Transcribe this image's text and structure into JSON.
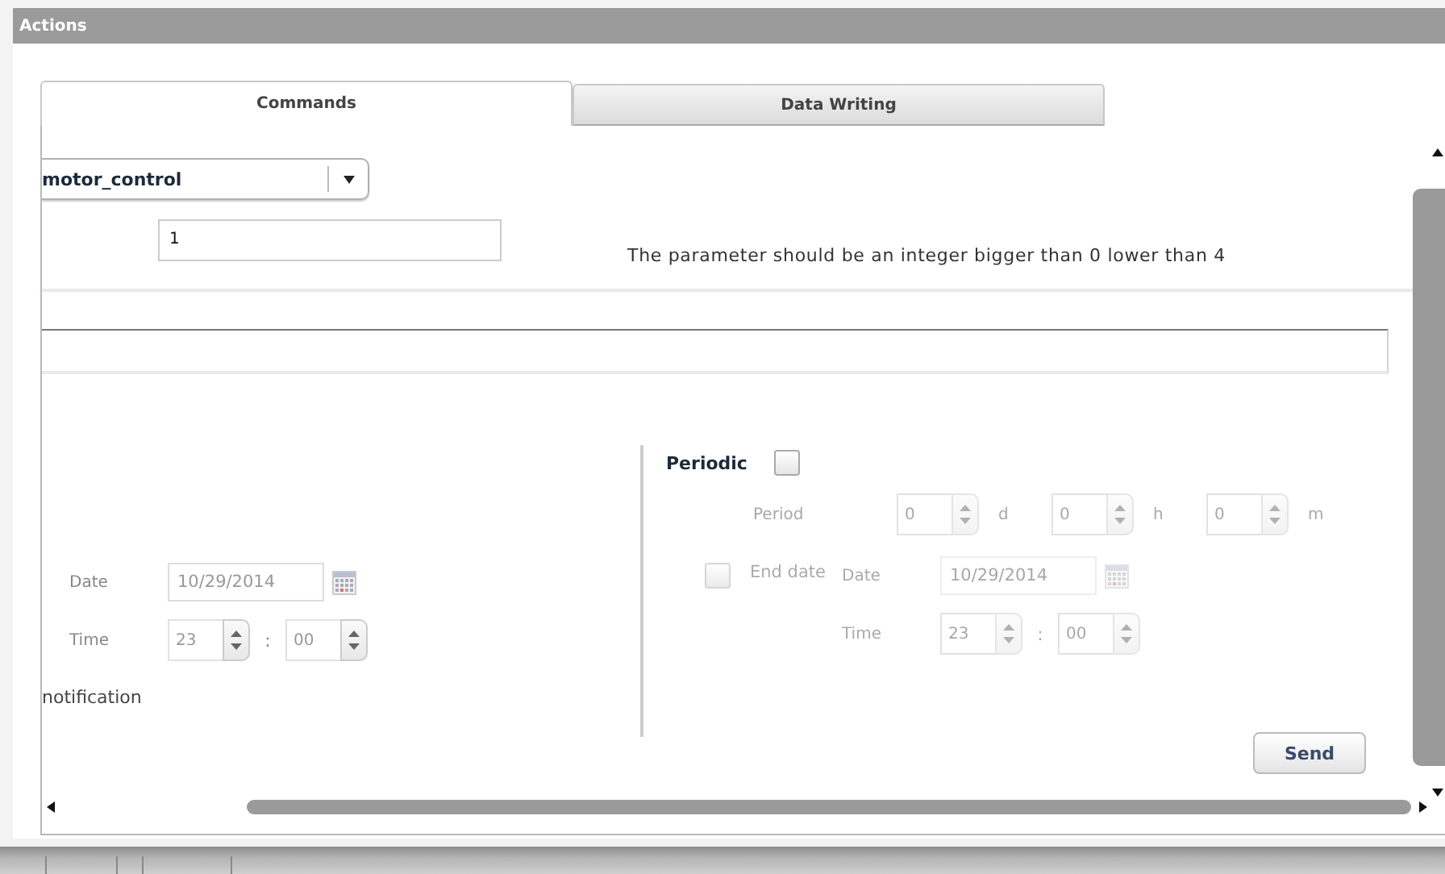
{
  "window": {
    "title": "Actions"
  },
  "tabs": [
    {
      "label": "Commands",
      "selected": true
    },
    {
      "label": "Data Writing",
      "selected": false
    }
  ],
  "command": {
    "value": "motor_control"
  },
  "parameter": {
    "value": "1",
    "hint": "The parameter should be an integer bigger than 0 lower than 4"
  },
  "schedule": {
    "date_label": "Date",
    "date": "10/29/2014",
    "time_label": "Time",
    "hour": "23",
    "separator": ":",
    "minute": "00",
    "disabled": false
  },
  "notification_label": "notification",
  "periodic": {
    "label": "Periodic",
    "checked": false,
    "period_label": "Period",
    "disabled": true,
    "period": [
      {
        "value": "0",
        "unit": "d"
      },
      {
        "value": "0",
        "unit": "h"
      },
      {
        "value": "0",
        "unit": "m"
      }
    ],
    "end_date": {
      "label": "End date",
      "checked": false,
      "disabled": true,
      "date_label": "Date",
      "date": "10/29/2014",
      "time_label": "Time",
      "hour": "23",
      "separator": ":",
      "minute": "00"
    }
  },
  "send_button": "Send"
}
